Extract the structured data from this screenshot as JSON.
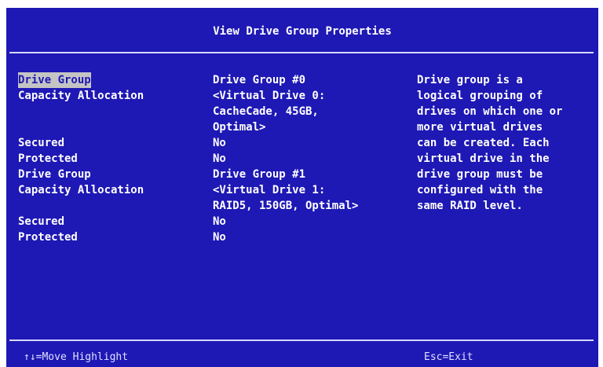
{
  "title": "View Drive Group Properties",
  "properties": [
    {
      "label": "Drive Group",
      "value": "Drive Group #0",
      "highlighted": true
    },
    {
      "label": "Capacity Allocation",
      "value": "<Virtual Drive 0:\nCacheCade, 45GB,\nOptimal>"
    },
    {
      "label": "Secured",
      "value": "No"
    },
    {
      "label": "Protected",
      "value": "No"
    },
    {
      "label": "Drive Group",
      "value": "Drive Group #1"
    },
    {
      "label": "Capacity Allocation",
      "value": "<Virtual Drive 1:\nRAID5, 150GB, Optimal>"
    },
    {
      "label": "Secured",
      "value": "No"
    },
    {
      "label": "Protected",
      "value": "No"
    }
  ],
  "help_text": "Drive group is a\nlogical grouping of\ndrives on which one or\nmore virtual drives\ncan be created. Each\nvirtual drive in the\ndrive group must be\nconfigured with the\nsame RAID level.",
  "footer": {
    "left": "↑↓=Move Highlight",
    "right": "Esc=Exit"
  },
  "colors": {
    "background": "#1e18b4",
    "text": "#ffffff",
    "highlight": "#c4c4c4"
  }
}
